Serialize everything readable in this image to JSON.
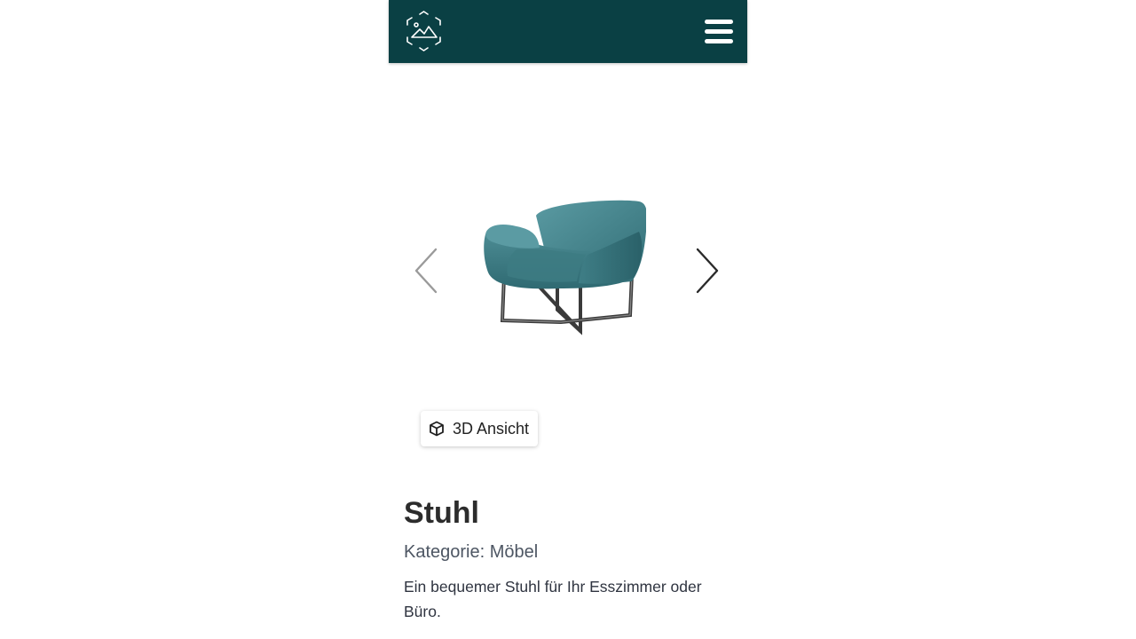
{
  "header": {
    "logo_icon": "ar-scan-mountain-icon",
    "menu_icon": "hamburger-menu-icon",
    "background_color": "#0a4044"
  },
  "viewer": {
    "image_subject": "teal-armchair",
    "prev_icon": "chevron-left-icon",
    "next_icon": "chevron-right-icon",
    "view3d_label": "3D Ansicht",
    "view3d_icon": "cube-icon"
  },
  "product": {
    "title": "Stuhl",
    "category": "Kategorie: Möbel",
    "description": "Ein bequemer Stuhl für Ihr Esszimmer oder Büro."
  }
}
